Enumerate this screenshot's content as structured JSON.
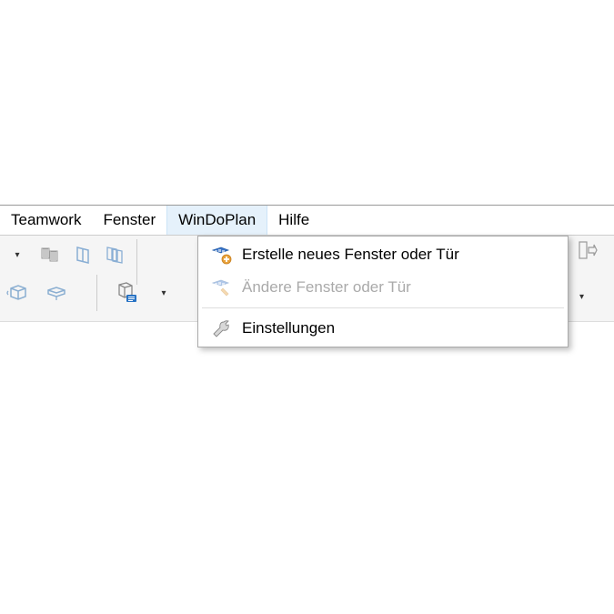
{
  "menubar": {
    "teamwork": "Teamwork",
    "fenster": "Fenster",
    "windoplan": "WinDoPlan",
    "hilfe": "Hilfe"
  },
  "dropdown": {
    "create": "Erstelle neues Fenster oder Tür",
    "modify": "Ändere Fenster oder Tür",
    "settings": "Einstellungen"
  },
  "icons": {
    "dropdown_arrow": "▾"
  },
  "colors": {
    "menu_active_bg": "#e5f1fb",
    "icon_blue": "#2873c4",
    "icon_orange": "#e8a13a"
  }
}
